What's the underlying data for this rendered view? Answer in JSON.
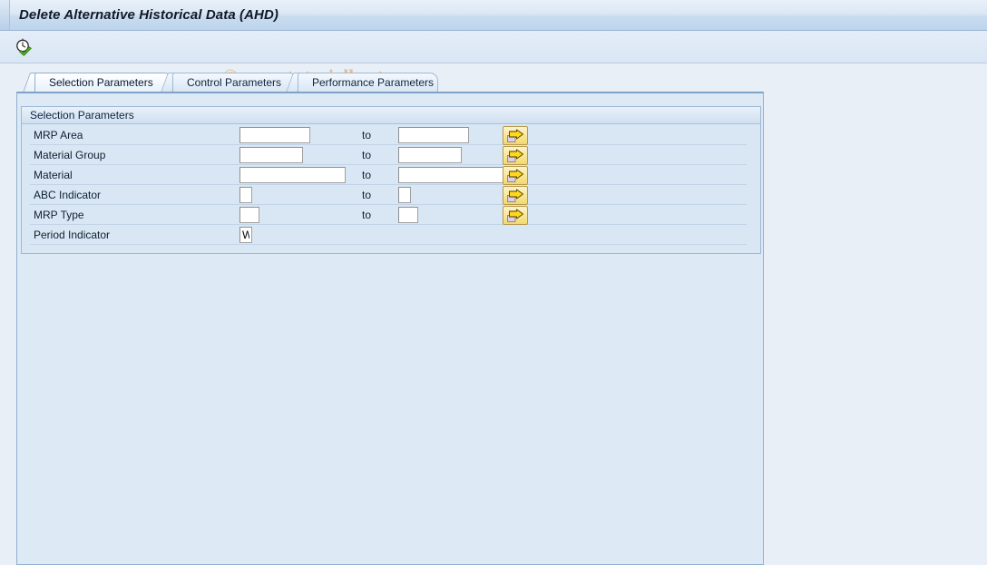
{
  "window": {
    "title": "Delete Alternative Historical Data (AHD)"
  },
  "toolbar": {
    "execute_icon": "clock-check-icon",
    "execute_tooltip": "Execute",
    "watermark": "© www.tutorialkart.com"
  },
  "tabs": [
    {
      "id": "selection-parameters",
      "label": "Selection Parameters",
      "active": true
    },
    {
      "id": "control-parameters",
      "label": "Control Parameters",
      "active": false
    },
    {
      "id": "performance-parameters",
      "label": "Performance Parameters",
      "active": false
    }
  ],
  "group": {
    "title": "Selection Parameters"
  },
  "rows": [
    {
      "id": "mrp-area",
      "label": "MRP Area",
      "from_value": "",
      "to_label": "to",
      "to_value": "",
      "multi_select_icon": "yellow-arrow-multiple-selection-icon"
    },
    {
      "id": "material-group",
      "label": "Material Group",
      "from_value": "",
      "to_label": "to",
      "to_value": "",
      "multi_select_icon": "yellow-arrow-multiple-selection-icon"
    },
    {
      "id": "material",
      "label": "Material",
      "from_value": "",
      "to_label": "to",
      "to_value": "",
      "multi_select_icon": "yellow-arrow-multiple-selection-icon"
    },
    {
      "id": "abc-indicator",
      "label": "ABC Indicator",
      "from_value": "",
      "to_label": "to",
      "to_value": "",
      "multi_select_icon": "yellow-arrow-multiple-selection-icon"
    },
    {
      "id": "mrp-type",
      "label": "MRP Type",
      "from_value": "",
      "to_label": "to",
      "to_value": "",
      "multi_select_icon": "yellow-arrow-multiple-selection-icon"
    },
    {
      "id": "period-indicator",
      "label": "Period Indicator",
      "from_value": "W"
    }
  ],
  "colors": {
    "title_bar_start": "#e8f0f9",
    "title_bar_end": "#bdd4ec",
    "page_background": "#e9eff7",
    "panel_background": "#dde9f5",
    "group_background": "#d9e7f4",
    "border": "#8fb0cf",
    "watermark": "#e8bb8b",
    "button_yellow": "#f8e79a"
  }
}
